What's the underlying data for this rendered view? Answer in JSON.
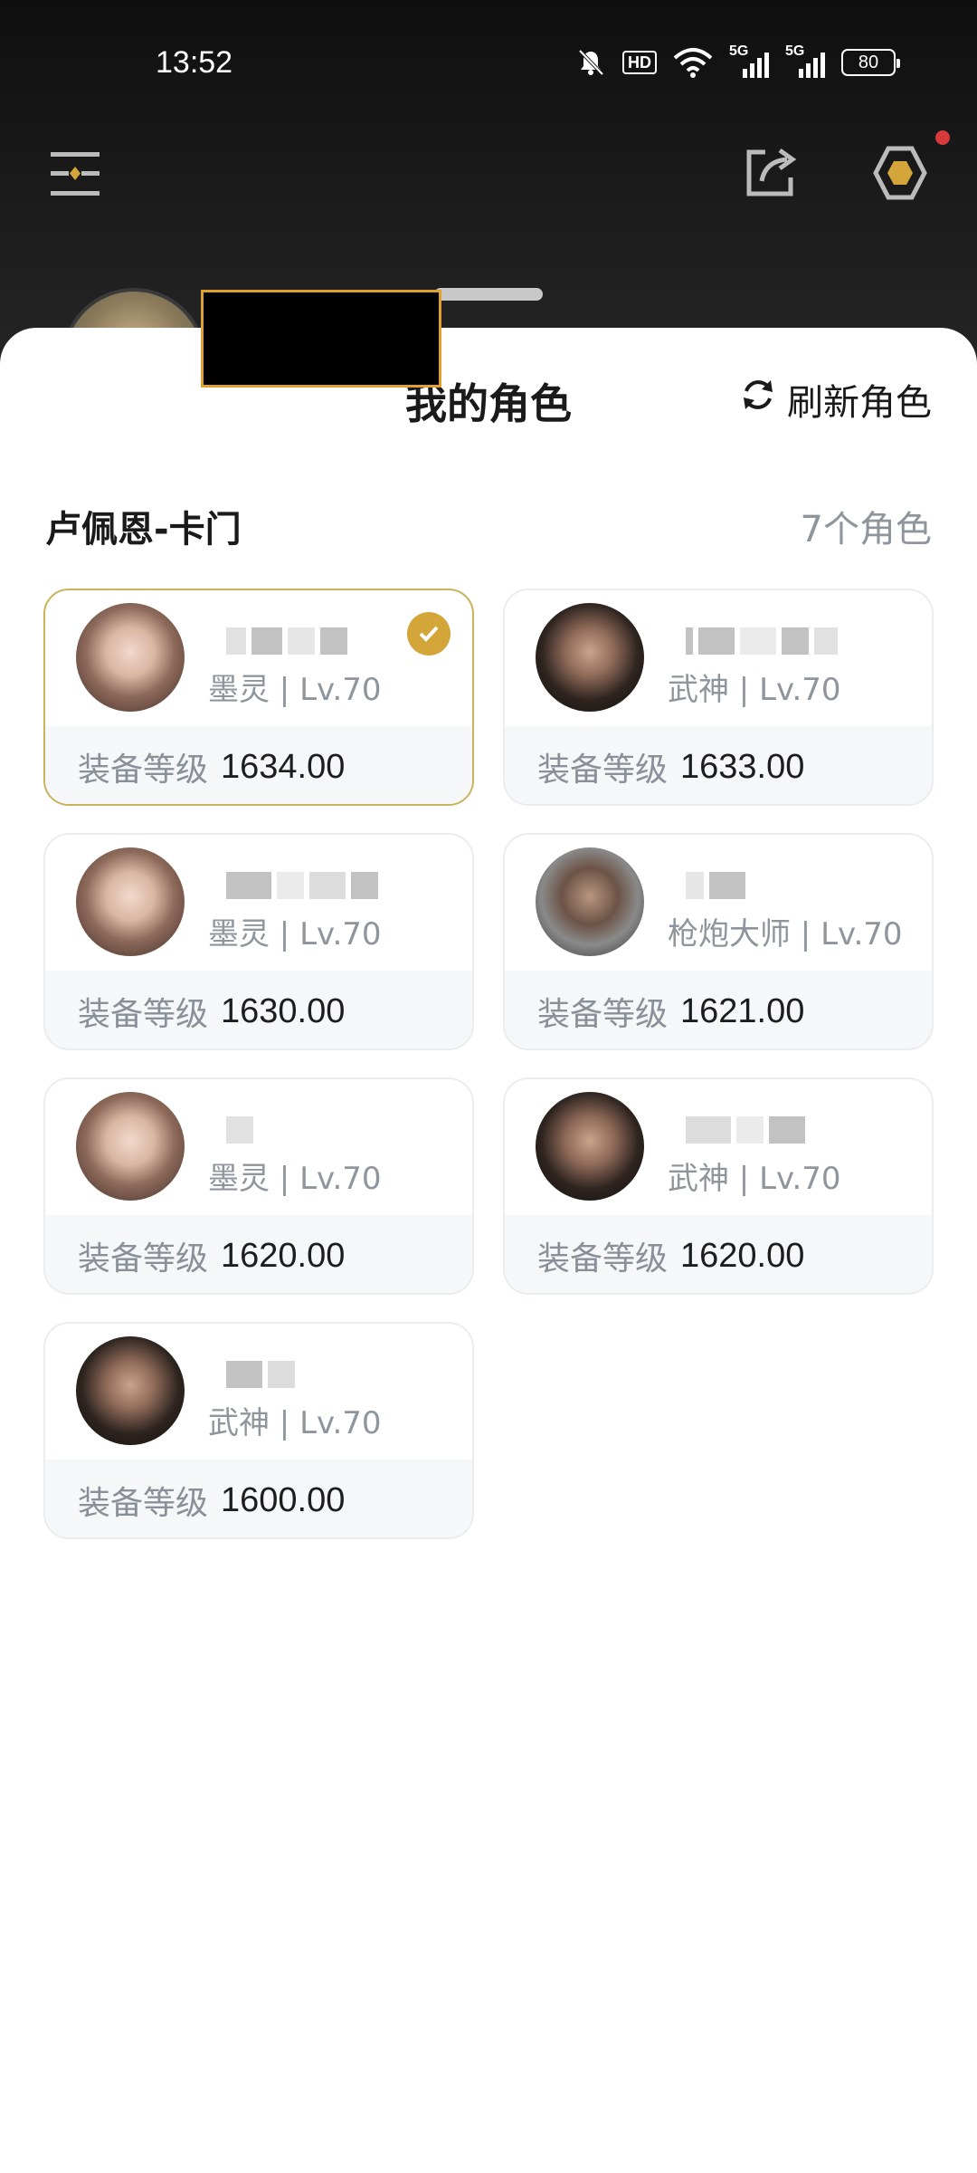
{
  "status_bar": {
    "time": "13:52",
    "hd_label": "HD",
    "net1": "5G",
    "net2": "5G",
    "battery": "80"
  },
  "header": {
    "icons": [
      "menu-icon",
      "share-icon",
      "settings-icon"
    ],
    "notification_color": "#d63a3a"
  },
  "sheet": {
    "title": "我的角色",
    "refresh_label": "刷新角色",
    "server_name": "卢佩恩-卡门",
    "role_count": "7个角色",
    "gear_label": "装备等级",
    "accent_color": "#d4a63a"
  },
  "characters": [
    {
      "class_level": "墨灵 | Lv.70",
      "gear_score": "1634.00",
      "selected": true,
      "avatar": "girl"
    },
    {
      "class_level": "武神 | Lv.70",
      "gear_score": "1633.00",
      "selected": false,
      "avatar": "warrior"
    },
    {
      "class_level": "墨灵 | Lv.70",
      "gear_score": "1630.00",
      "selected": false,
      "avatar": "girl"
    },
    {
      "class_level": "枪炮大师 | Lv.70",
      "gear_score": "1621.00",
      "selected": false,
      "avatar": "gunner"
    },
    {
      "class_level": "墨灵 | Lv.70",
      "gear_score": "1620.00",
      "selected": false,
      "avatar": "girl"
    },
    {
      "class_level": "武神 | Lv.70",
      "gear_score": "1620.00",
      "selected": false,
      "avatar": "warrior"
    },
    {
      "class_level": "武神 | Lv.70",
      "gear_score": "1600.00",
      "selected": false,
      "avatar": "warrior"
    }
  ]
}
